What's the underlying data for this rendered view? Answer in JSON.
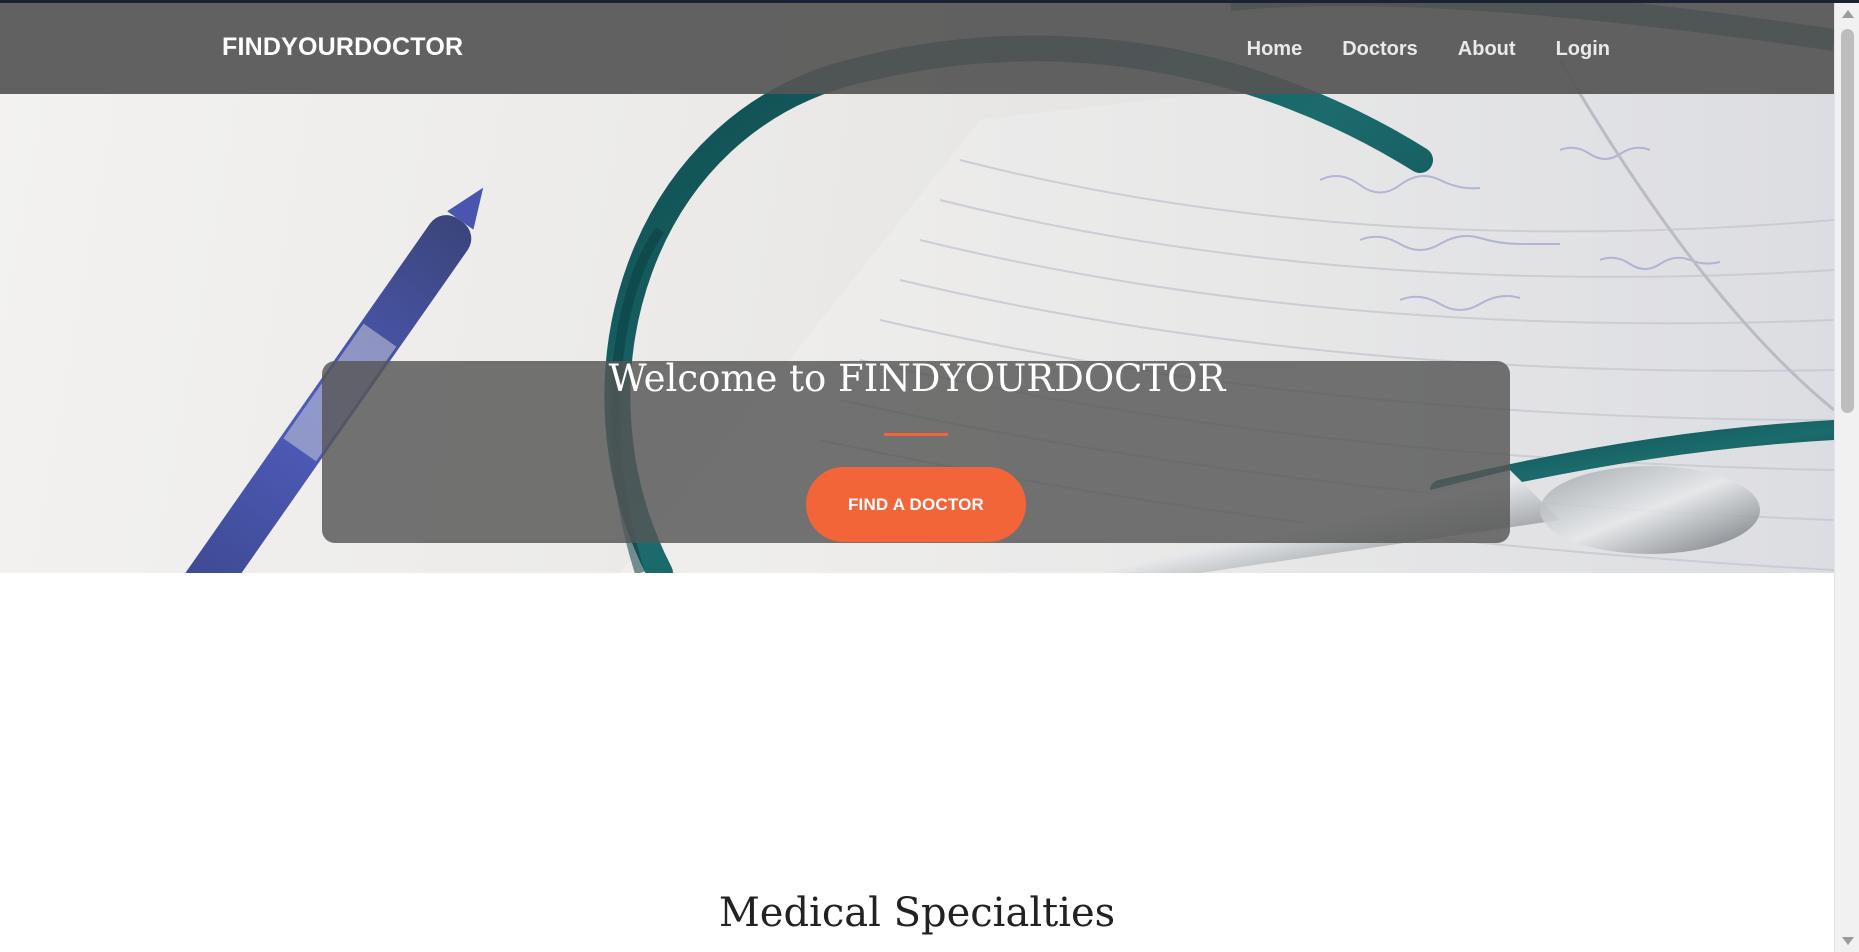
{
  "navbar": {
    "brand": "FINDYOURDOCTOR",
    "links": [
      {
        "label": "Home"
      },
      {
        "label": "Doctors"
      },
      {
        "label": "About"
      },
      {
        "label": "Login"
      }
    ]
  },
  "hero": {
    "title": "Welcome to FINDYOURDOCTOR",
    "cta_label": "FIND A DOCTOR"
  },
  "section": {
    "heading": "Medical Specialties"
  },
  "colors": {
    "accent": "#f26539",
    "navbar_bg": "#555555",
    "heading_text": "#222222"
  }
}
